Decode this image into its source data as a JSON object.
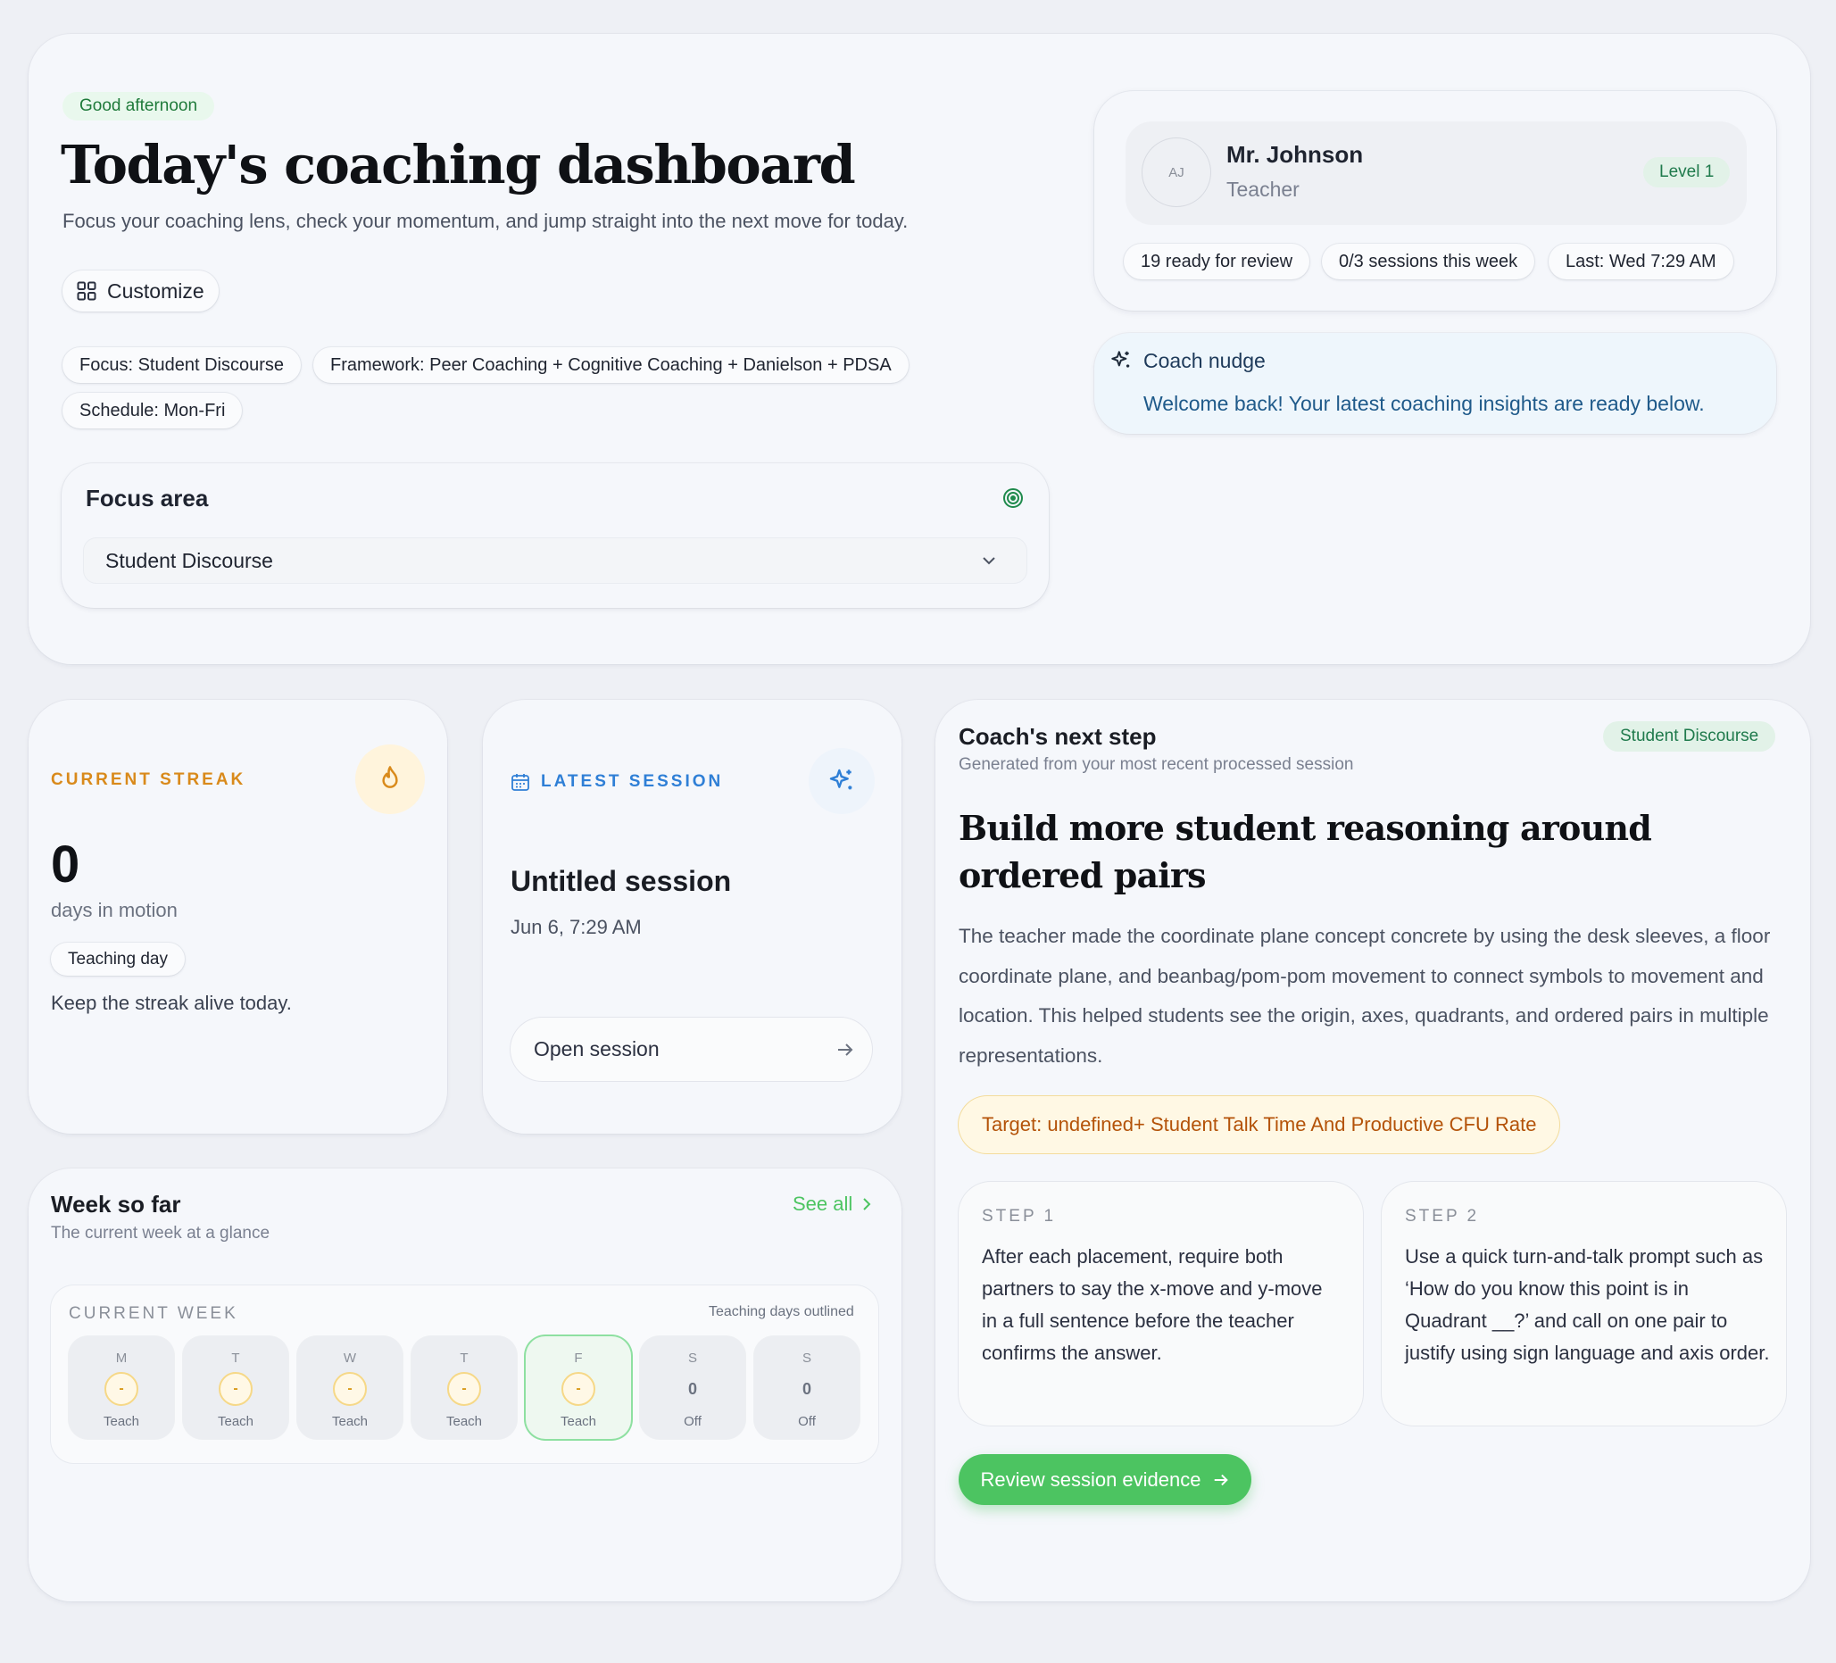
{
  "header": {
    "greeting_badge": "Good afternoon",
    "title": "Today's coaching dashboard",
    "subtitle": "Focus your coaching lens, check your momentum, and jump straight into the next move for today.",
    "customize_label": "Customize",
    "chips": [
      "Focus: Student Discourse",
      "Framework: Peer Coaching + Cognitive Coaching + Danielson + PDSA",
      "Schedule: Mon-Fri"
    ]
  },
  "focus_area": {
    "label": "Focus area",
    "selected": "Student Discourse"
  },
  "profile": {
    "initials": "AJ",
    "name": "Mr. Johnson",
    "role": "Teacher",
    "level": "Level 1",
    "stats": [
      "19 ready for review",
      "0/3 sessions this week",
      "Last: Wed 7:29 AM"
    ]
  },
  "nudge": {
    "title": "Coach nudge",
    "message": "Welcome back! Your latest coaching insights are ready below."
  },
  "streak": {
    "label": "CURRENT STREAK",
    "value": "0",
    "unit": "days in motion",
    "badge": "Teaching day",
    "message": "Keep the streak alive today."
  },
  "latest_session": {
    "label": "LATEST SESSION",
    "title": "Untitled session",
    "date": "Jun 6, 7:29 AM",
    "open_label": "Open session"
  },
  "week": {
    "title": "Week so far",
    "subtitle": "The current week at a glance",
    "see_all": "See all",
    "current_week_label": "CURRENT WEEK",
    "note": "Teaching days outlined",
    "days": [
      {
        "letter": "M",
        "count": "-",
        "status": "Teach"
      },
      {
        "letter": "T",
        "count": "-",
        "status": "Teach"
      },
      {
        "letter": "W",
        "count": "-",
        "status": "Teach"
      },
      {
        "letter": "T",
        "count": "-",
        "status": "Teach"
      },
      {
        "letter": "F",
        "count": "-",
        "status": "Teach"
      },
      {
        "letter": "S",
        "count": "0",
        "status": "Off"
      },
      {
        "letter": "S",
        "count": "0",
        "status": "Off"
      }
    ]
  },
  "next_step": {
    "title": "Coach's next step",
    "subtitle": "Generated from your most recent processed session",
    "tag": "Student Discourse",
    "headline": "Build more student reasoning around ordered pairs",
    "body": "The teacher made the coordinate plane concept concrete by using the desk sleeves, a floor coordinate plane, and beanbag/pom-pom movement to connect symbols to movement and location. This helped students see the origin, axes, quadrants, and ordered pairs in multiple representations.",
    "target": "Target: undefined+ Student Talk Time And Productive CFU Rate",
    "steps": [
      {
        "label": "STEP 1",
        "text": "After each placement, require both partners to say the x-move and y-move in a full sentence before the teacher confirms the answer."
      },
      {
        "label": "STEP 2",
        "text": "Use a quick turn-and-talk prompt such as ‘How do you know this point is in Quadrant __?’ and call on one pair to justify using sign language and axis order."
      }
    ],
    "cta": "Review session evidence"
  },
  "colors": {
    "accent_green": "#4cc461",
    "streak_orange": "#d98a1b",
    "session_blue": "#2f7fd6",
    "target_text": "#b45309"
  }
}
